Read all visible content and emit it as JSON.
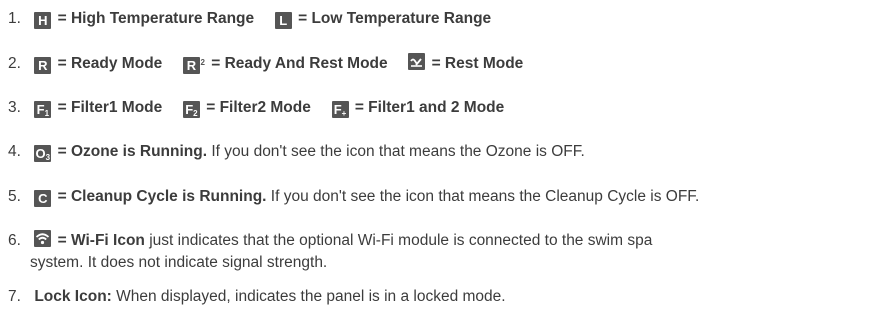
{
  "items": [
    {
      "num": "1.",
      "parts": [
        {
          "icon_glyph": "H",
          "icon_name": "high-temperature-range-icon",
          "text": "= High Temperature Range"
        },
        {
          "icon_glyph": "L",
          "icon_name": "low-temperature-range-icon",
          "text": "= Low Temperature Range"
        }
      ]
    },
    {
      "num": "2.",
      "parts": [
        {
          "icon_glyph": "R",
          "icon_name": "ready-mode-icon",
          "text": " = Ready Mode"
        },
        {
          "icon_glyph": "R",
          "icon_sup": "2",
          "icon_name": "ready-and-rest-mode-icon",
          "text": "= Ready And Rest Mode"
        },
        {
          "icon_name": "rest-mode-icon",
          "text": "= Rest Mode"
        }
      ]
    },
    {
      "num": "3.",
      "parts": [
        {
          "icon_glyph": "F",
          "icon_sub": "1",
          "icon_name": "filter1-mode-icon",
          "text": "= Filter1 Mode"
        },
        {
          "icon_glyph": "F",
          "icon_sub": "2",
          "icon_name": "filter2-mode-icon",
          "text": "= Filter2 Mode"
        },
        {
          "icon_glyph": "F",
          "icon_sub": "+",
          "icon_name": "filter1-and-2-mode-icon",
          "text": "= Filter1 and 2 Mode"
        }
      ]
    },
    {
      "num": "4.",
      "icon_glyph": "O",
      "icon_sub": "3",
      "icon_name": "ozone-icon",
      "bold": "= Ozone is Running.",
      "rest": " If you don't see the icon that means the Ozone is OFF."
    },
    {
      "num": "5.",
      "icon_glyph": "C",
      "icon_name": "cleanup-cycle-icon",
      "bold": "= Cleanup Cycle is Running.",
      "rest": " If you don't see the icon that means the Cleanup Cycle is OFF."
    },
    {
      "num": "6.",
      "icon_name": "wifi-icon",
      "bold": "= Wi-Fi Icon",
      "rest": " just indicates that the optional Wi-Fi module is connected to the swim spa",
      "continuation": "system. It does not indicate signal strength."
    },
    {
      "num": "7.",
      "bold": "Lock Icon:",
      "rest": " When displayed, indicates the panel is in a locked mode."
    }
  ]
}
